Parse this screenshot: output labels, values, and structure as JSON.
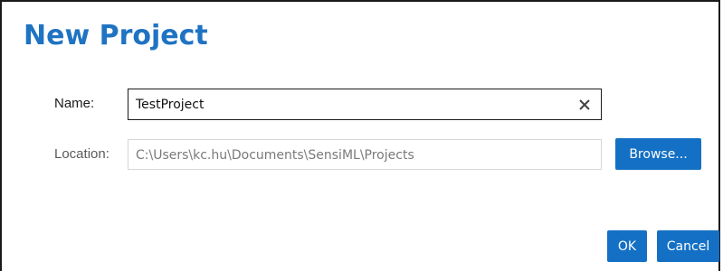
{
  "dialog": {
    "title": "New Project",
    "name_label": "Name:",
    "name_value": "TestProject",
    "location_label": "Location:",
    "location_value": "C:\\Users\\kc.hu\\Documents\\SensiML\\Projects",
    "clear_icon": "close-icon",
    "browse_label": "Browse...",
    "ok_label": "OK",
    "cancel_label": "Cancel"
  },
  "colors": {
    "title": "#1f73c2",
    "button": "#1470c4"
  }
}
